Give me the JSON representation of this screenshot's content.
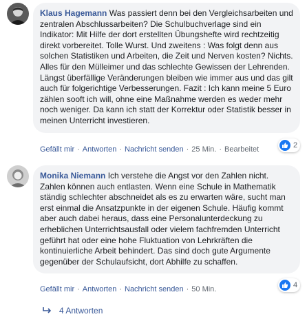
{
  "comments": [
    {
      "author": "Klaus Hagemann",
      "text": "Was passiert denn bei den Vergleichsarbeiten und zentralen Abschlussarbeiten? Die Schulbuchverlage sind ein Indikator: Mit Hilfe der dort erstellten Übungshefte wird rechtzeitig direkt vorbereitet. Tolle Wurst. Und zweitens : Was folgt denn aus solchen Statistiken und Arbeiten, die Zeit und Nerven kosten? Nichts. Alles für den Mülleimer und das schlechte Gewissen der Lehrenden. Längst überfällige Veränderungen bleiben wie immer aus und das gilt auch für folgerichtige Verbesserungen. Fazit : Ich kann meine 5 Euro zählen sooft ich will, ohne eine Maßnahme werden es weder mehr noch weniger. Da kann ich statt der Korrektur oder Statistik besser in meinen Unterricht investieren.",
      "reaction_count": "2",
      "actions": {
        "like": "Gefällt mir",
        "reply": "Antworten",
        "message": "Nachricht senden",
        "time": "25 Min.",
        "edited": "Bearbeitet"
      },
      "avatar_icon": "profile-photo-dark"
    },
    {
      "author": "Monika Niemann",
      "text": "Ich verstehe die Angst vor den Zahlen nicht. Zahlen können auch entlasten. Wenn eine Schule in Mathematik ständig schlechter abschneidet als es zu erwarten wäre, sucht man erst einmal die Ansatzpunkte in der eigenen Schule. Häufig kommt aber auch dabei heraus, dass eine Personalunterdeckung zu erheblichen Unterrichtsausfall oder vielem fachfremden Unterricht geführt hat oder eine hohe Fluktuation von Lehrkräften die kontinuierliche Arbeit behindert. Das sind doch gute Argumente gegenüber der Schulaufsicht, dort Abhilfe zu schaffen.",
      "reaction_count": "4",
      "actions": {
        "like": "Gefällt mir",
        "reply": "Antworten",
        "message": "Nachricht senden",
        "time": "50 Min."
      },
      "avatar_icon": "profile-photo-light"
    }
  ],
  "replies_link": "4 Antworten",
  "separator": "·",
  "colors": {
    "link": "#385898",
    "bubble": "#f2f3f5",
    "like": "#1877f2",
    "meta": "#606770"
  },
  "icons": {
    "reaction": "thumbs-up-icon",
    "replies": "reply-arrow-icon"
  }
}
